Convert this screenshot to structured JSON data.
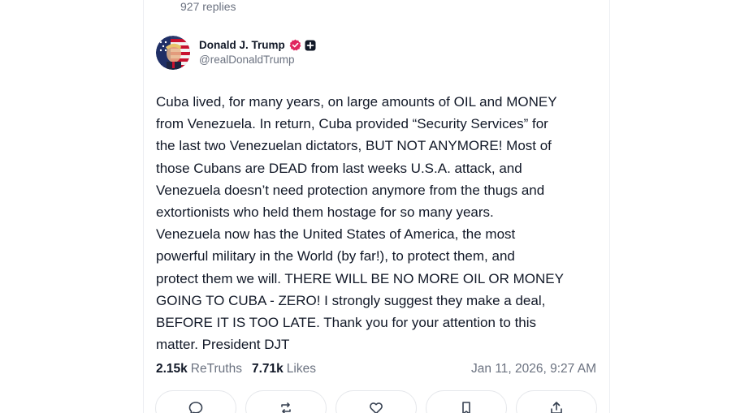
{
  "previous_post": {
    "replies_label": "927 replies"
  },
  "post": {
    "author": {
      "display_name": "Donald J. Trump",
      "handle": "@realDonaldTrump",
      "verified_icon": "verified-badge-icon",
      "plus_icon": "plus-badge-icon"
    },
    "body": "Cuba lived, for many years, on large amounts of OIL and MONEY\nfrom Venezuela. In return, Cuba provided “Security Services” for\nthe last two Venezuelan dictators, BUT NOT ANYMORE! Most of\nthose Cubans are DEAD from last weeks U.S.A. attack, and\nVenezuela doesn’t need protection anymore from the thugs and\nextortionists who held them hostage for so many years.\nVenezuela now has the United States of America, the most\npowerful military in the World (by far!), to protect them, and\nprotect them we will. THERE WILL BE NO MORE OIL OR MONEY\nGOING TO CUBA - ZERO! I strongly suggest they make a deal,\nBEFORE IT IS TOO LATE. Thank you for your attention to this\nmatter. President DJT",
    "stats": {
      "retruths_count": "2.15k",
      "retruths_label": "ReTruths",
      "likes_count": "7.71k",
      "likes_label": "Likes"
    },
    "timestamp": "Jan 11, 2026, 9:27 AM",
    "actions": [
      {
        "name": "reply-button",
        "icon": "comment-icon"
      },
      {
        "name": "retruth-button",
        "icon": "repost-icon"
      },
      {
        "name": "like-button",
        "icon": "heart-icon"
      },
      {
        "name": "bookmark-button",
        "icon": "bookmark-icon"
      },
      {
        "name": "share-button",
        "icon": "share-icon"
      }
    ]
  },
  "colors": {
    "text": "#111827",
    "muted": "#6b7280",
    "border": "#e5e7eb",
    "verified": "#e0245e"
  }
}
